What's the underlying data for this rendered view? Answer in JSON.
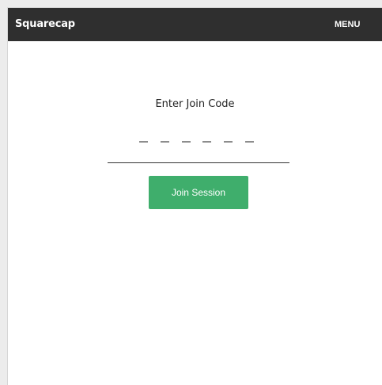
{
  "navbar": {
    "brand": "Squarecap",
    "menu_label": "MENU"
  },
  "join": {
    "prompt": "Enter Join Code",
    "code_value": "",
    "code_slots": 6,
    "button_label": "Join Session"
  },
  "colors": {
    "navbar_bg": "#2f2f2f",
    "button_bg": "#3fae6c",
    "slot_dash": "#8d8d8d"
  }
}
